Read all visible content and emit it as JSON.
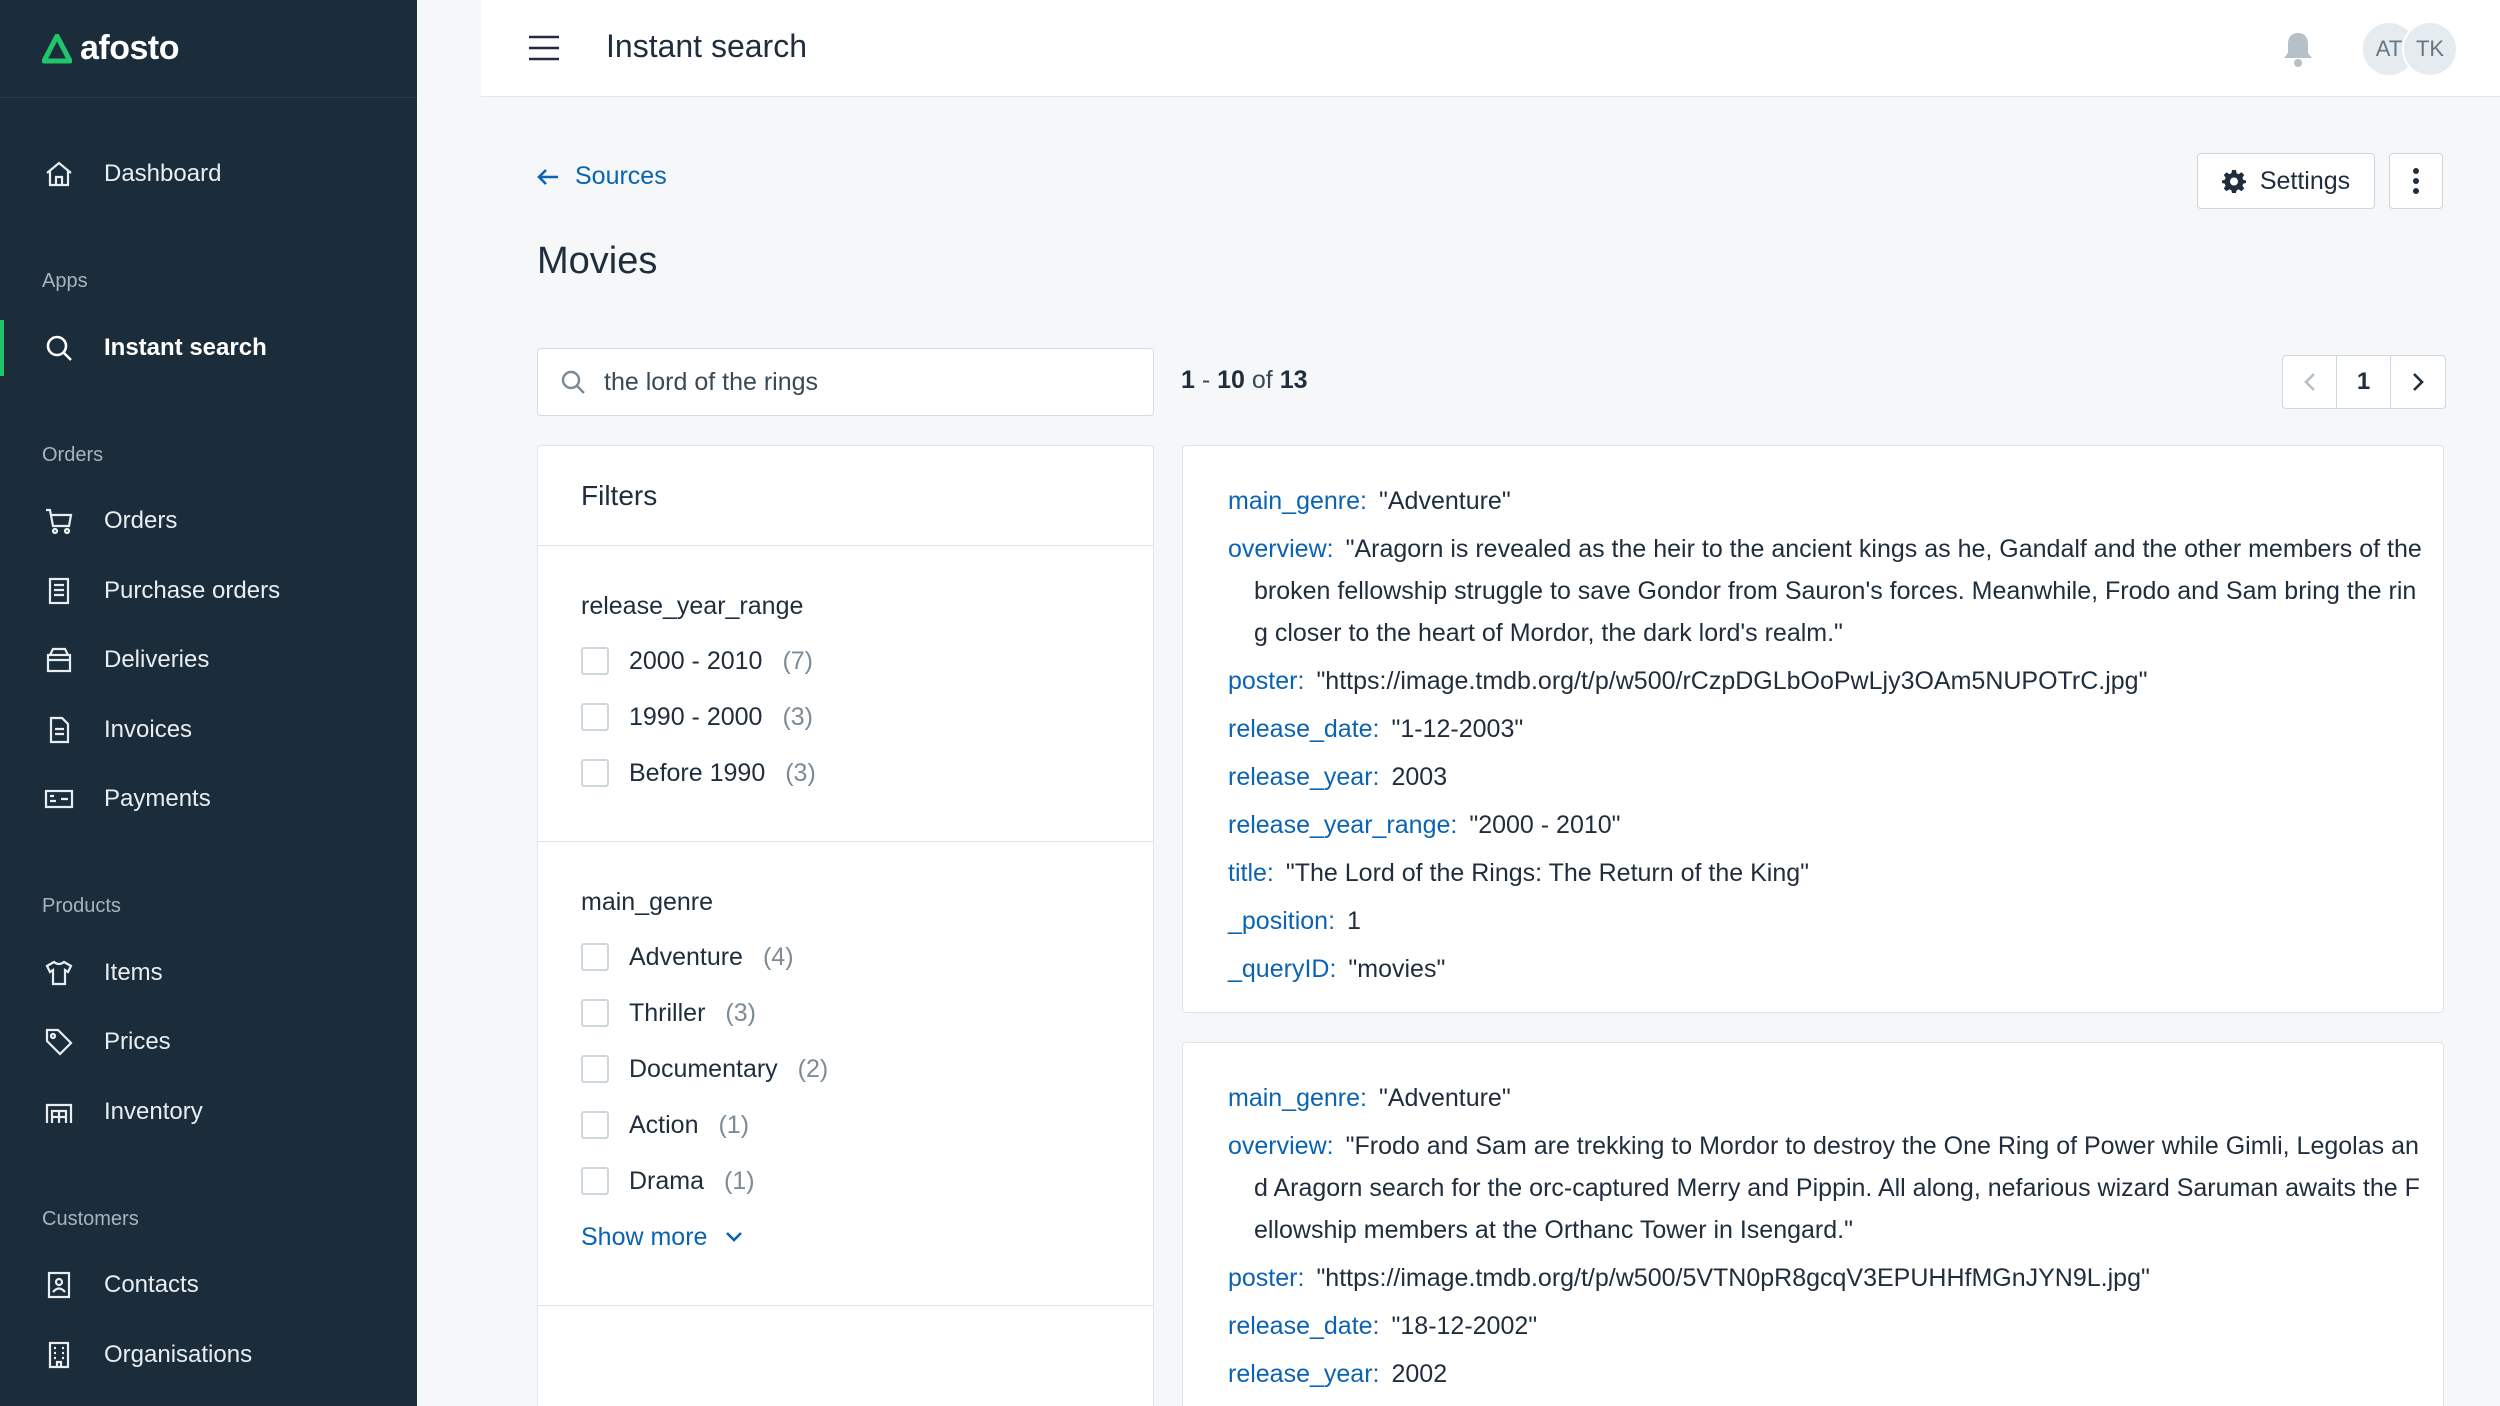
{
  "brand": {
    "name": "afosto",
    "accent": "#21c56c"
  },
  "sidebar": {
    "dashboard": "Dashboard",
    "sections": {
      "apps": "Apps",
      "orders": "Orders",
      "products": "Products",
      "customers": "Customers"
    },
    "items": {
      "instant_search": "Instant search",
      "orders": "Orders",
      "purchase_orders": "Purchase orders",
      "deliveries": "Deliveries",
      "invoices": "Invoices",
      "payments": "Payments",
      "items": "Items",
      "prices": "Prices",
      "inventory": "Inventory",
      "contacts": "Contacts",
      "organisations": "Organisations"
    }
  },
  "header": {
    "title": "Instant search",
    "avatars": [
      "AT",
      "TK"
    ]
  },
  "main": {
    "back_label": "Sources",
    "page_title": "Movies",
    "settings_label": "Settings",
    "search": {
      "value": "the lord of the rings",
      "placeholder": ""
    },
    "result_count": {
      "from": "1",
      "sep": " - ",
      "to": "10",
      "of": " of ",
      "total": "13"
    },
    "pager": {
      "current": "1"
    }
  },
  "filters": {
    "title": "Filters",
    "release_year_range": {
      "title": "release_year_range",
      "options": [
        {
          "label": "2000 - 2010",
          "count": "(7)"
        },
        {
          "label": "1990 - 2000",
          "count": "(3)"
        },
        {
          "label": "Before 1990",
          "count": "(3)"
        }
      ]
    },
    "main_genre": {
      "title": "main_genre",
      "options": [
        {
          "label": "Adventure",
          "count": "(4)"
        },
        {
          "label": "Thriller",
          "count": "(3)"
        },
        {
          "label": "Documentary",
          "count": "(2)"
        },
        {
          "label": "Action",
          "count": "(1)"
        },
        {
          "label": "Drama",
          "count": "(1)"
        }
      ],
      "show_more": "Show more"
    }
  },
  "results": [
    {
      "fields": [
        {
          "key": "main_genre:",
          "value": "\"Adventure\""
        },
        {
          "key": "overview:",
          "value": "\"Aragorn is revealed as the heir to the ancient kings as he, Gandalf and the other members of the broken fellowship struggle to save Gondor from Sauron's forces. Meanwhile, Frodo and Sam bring the ring closer to the heart of Mordor, the dark lord's realm.\""
        },
        {
          "key": "poster:",
          "value": "\"https://image.tmdb.org/t/p/w500/rCzpDGLbOoPwLjy3OAm5NUPOTrC.jpg\""
        },
        {
          "key": "release_date:",
          "value": "\"1-12-2003\""
        },
        {
          "key": "release_year:",
          "value": "2003"
        },
        {
          "key": "release_year_range:",
          "value": "\"2000 - 2010\""
        },
        {
          "key": "title:",
          "value": "\"The Lord of the Rings: The Return of the King\""
        },
        {
          "key": "_position:",
          "value": "1"
        },
        {
          "key": "_queryID:",
          "value": "\"movies\""
        }
      ]
    },
    {
      "fields": [
        {
          "key": "main_genre:",
          "value": "\"Adventure\""
        },
        {
          "key": "overview:",
          "value": "\"Frodo and Sam are trekking to Mordor to destroy the One Ring of Power while Gimli, Legolas and Aragorn search for the orc-captured Merry and Pippin. All along, nefarious wizard Saruman awaits the Fellowship members at the Orthanc Tower in Isengard.\""
        },
        {
          "key": "poster:",
          "value": "\"https://image.tmdb.org/t/p/w500/5VTN0pR8gcqV3EPUHHfMGnJYN9L.jpg\""
        },
        {
          "key": "release_date:",
          "value": "\"18-12-2002\""
        },
        {
          "key": "release_year:",
          "value": "2002"
        }
      ]
    }
  ]
}
